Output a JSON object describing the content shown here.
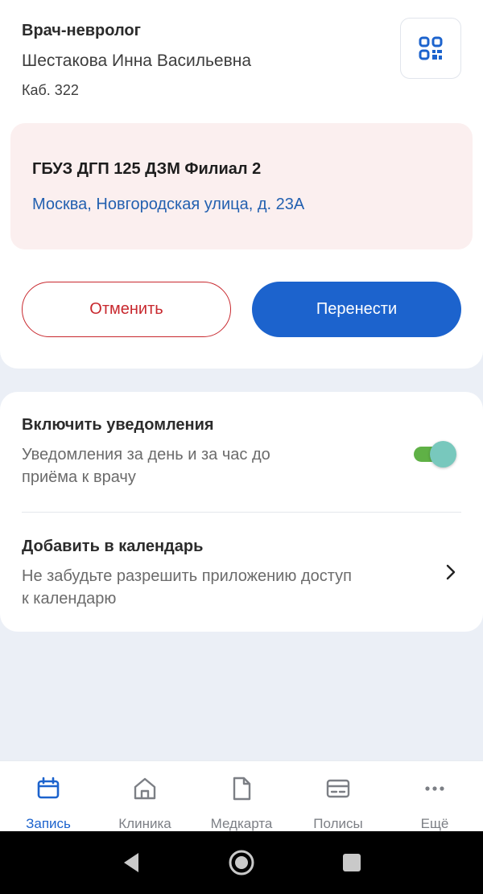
{
  "appointment": {
    "specialty": "Врач-невролог",
    "doctor_name": "Шестакова Инна Васильевна",
    "room": "Каб. 322",
    "qr_icon": "qr-code-icon"
  },
  "clinic": {
    "name": "ГБУЗ ДГП 125 ДЗМ Филиал 2",
    "address": "Москва, Новгородская улица, д. 23А"
  },
  "actions": {
    "cancel_label": "Отменить",
    "reschedule_label": "Перенести"
  },
  "settings": {
    "notifications": {
      "title": "Включить уведомления",
      "description": "Уведомления за день и за час до приёма к врачу",
      "enabled": true
    },
    "calendar": {
      "title": "Добавить в календарь",
      "description": "Не забудьте разрешить приложению доступ к календарю"
    }
  },
  "bottom_nav": {
    "items": [
      {
        "label": "Запись",
        "icon": "calendar-icon",
        "active": true
      },
      {
        "label": "Клиника",
        "icon": "home-icon",
        "active": false
      },
      {
        "label": "Медкарта",
        "icon": "document-icon",
        "active": false
      },
      {
        "label": "Полисы",
        "icon": "card-icon",
        "active": false
      },
      {
        "label": "Ещё",
        "icon": "more-icon",
        "active": false
      }
    ]
  },
  "colors": {
    "accent": "#1c63cd",
    "danger": "#c8282e",
    "clinic_bg": "#fbefef",
    "toggle_on": "#5fb146"
  }
}
